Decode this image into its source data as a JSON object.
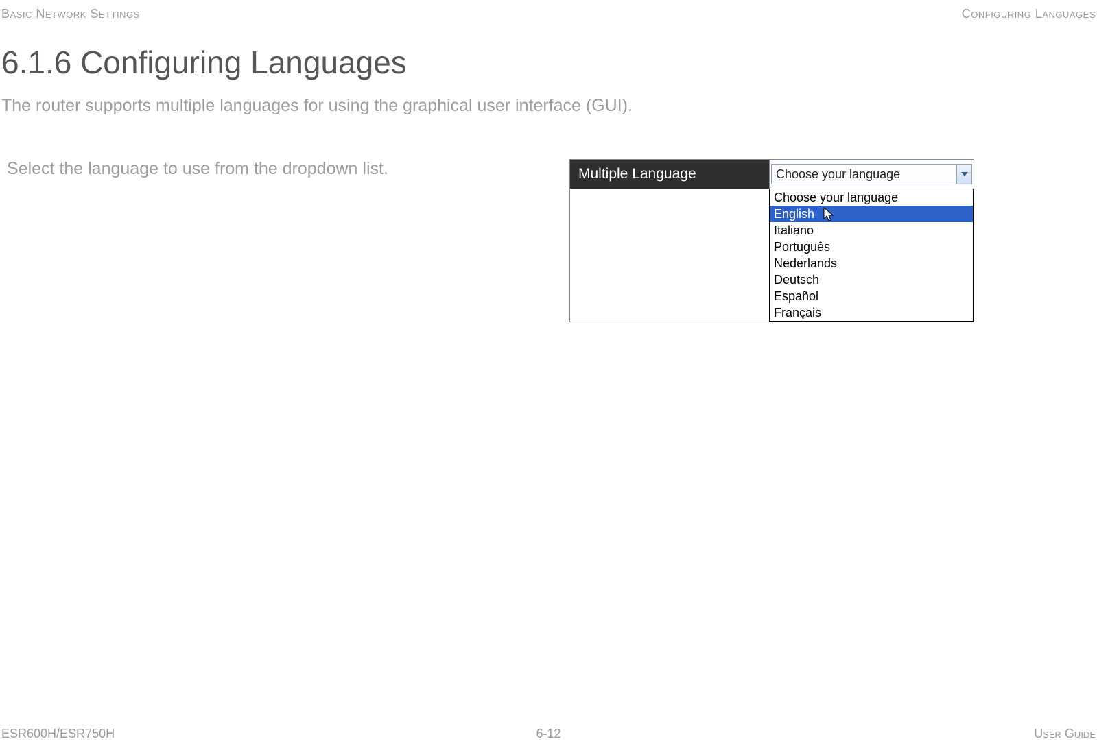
{
  "header": {
    "left": "Basic Network Settings",
    "right": "Configuring Languages"
  },
  "title": "6.1.6 Configuring Languages",
  "intro": "The router supports multiple languages for using the graphical user interface (GUI).",
  "instruction": "Select the language to use from the dropdown list.",
  "panel": {
    "label": "Multiple Language",
    "selected_display": "Choose your language",
    "options": [
      "Choose your language",
      "English",
      "Italiano",
      "Português",
      "Nederlands",
      "Deutsch",
      "Español",
      "Français"
    ],
    "highlighted_index": 1
  },
  "footer": {
    "left": "ESR600H/ESR750H",
    "center": "6-12",
    "right": "User Guide"
  }
}
